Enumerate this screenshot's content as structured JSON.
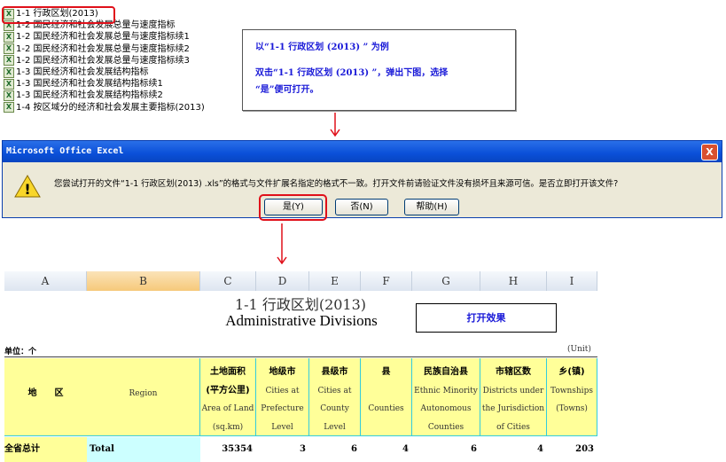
{
  "file_list": [
    "1-1 行政区划(2013)",
    "1-2 国民经济和社会发展总量与速度指标",
    "1-2 国民经济和社会发展总量与速度指标续1",
    "1-2 国民经济和社会发展总量与速度指标续2",
    "1-2 国民经济和社会发展总量与速度指标续3",
    "1-3 国民经济和社会发展结构指标",
    "1-3 国民经济和社会发展结构指标续1",
    "1-3 国民经济和社会发展结构指标续2",
    "1-4 按区域分的经济和社会发展主要指标(2013)"
  ],
  "note": {
    "line1": "以“1-1 行政区划 (2013) ” 为例",
    "line2": "双击“1-1 行政区划 (2013) ”，弹出下图，选择",
    "line3": "“是”便可打开。"
  },
  "dialog": {
    "title": "Microsoft Office Excel",
    "message": "您尝试打开的文件“1-1 行政区划(2013) .xls”的格式与文件扩展名指定的格式不一致。打开文件前请验证文件没有损坏且来源可信。是否立即打开该文件?",
    "yes": "是(Y)",
    "no": "否(N)",
    "help": "帮助(H)",
    "close": "X"
  },
  "sheet": {
    "columns": [
      "A",
      "B",
      "C",
      "D",
      "E",
      "F",
      "G",
      "H",
      "I"
    ],
    "title_cn": "1-1  行政区划(2013)",
    "title_en": "Administrative Divisions",
    "label_box": "打开效果",
    "unit_left": "单位：个",
    "unit_right": "(Unit)",
    "headers": [
      {
        "cn": "地　　区",
        "en": ""
      },
      {
        "cn": "",
        "en": "Region"
      },
      {
        "cn": "土地面积\n(平方公里)",
        "en": "Area of Land\n(sq.km)"
      },
      {
        "cn": "地级市",
        "en": "Cities at\nPrefecture\nLevel"
      },
      {
        "cn": "县级市",
        "en": "Cities at\nCounty\nLevel"
      },
      {
        "cn": "县",
        "en": "\nCounties"
      },
      {
        "cn": "民族自治县",
        "en": "Ethnic Minority\nAutonomous\nCounties"
      },
      {
        "cn": "市辖区数",
        "en": "Districts under\nthe Jurisdiction\nof Cities"
      },
      {
        "cn": "乡(镇)",
        "en": "Townships\n(Towns)"
      }
    ],
    "row": [
      "全省总计",
      "Total",
      "35354",
      "3",
      "6",
      "4",
      "6",
      "4",
      "203"
    ]
  }
}
